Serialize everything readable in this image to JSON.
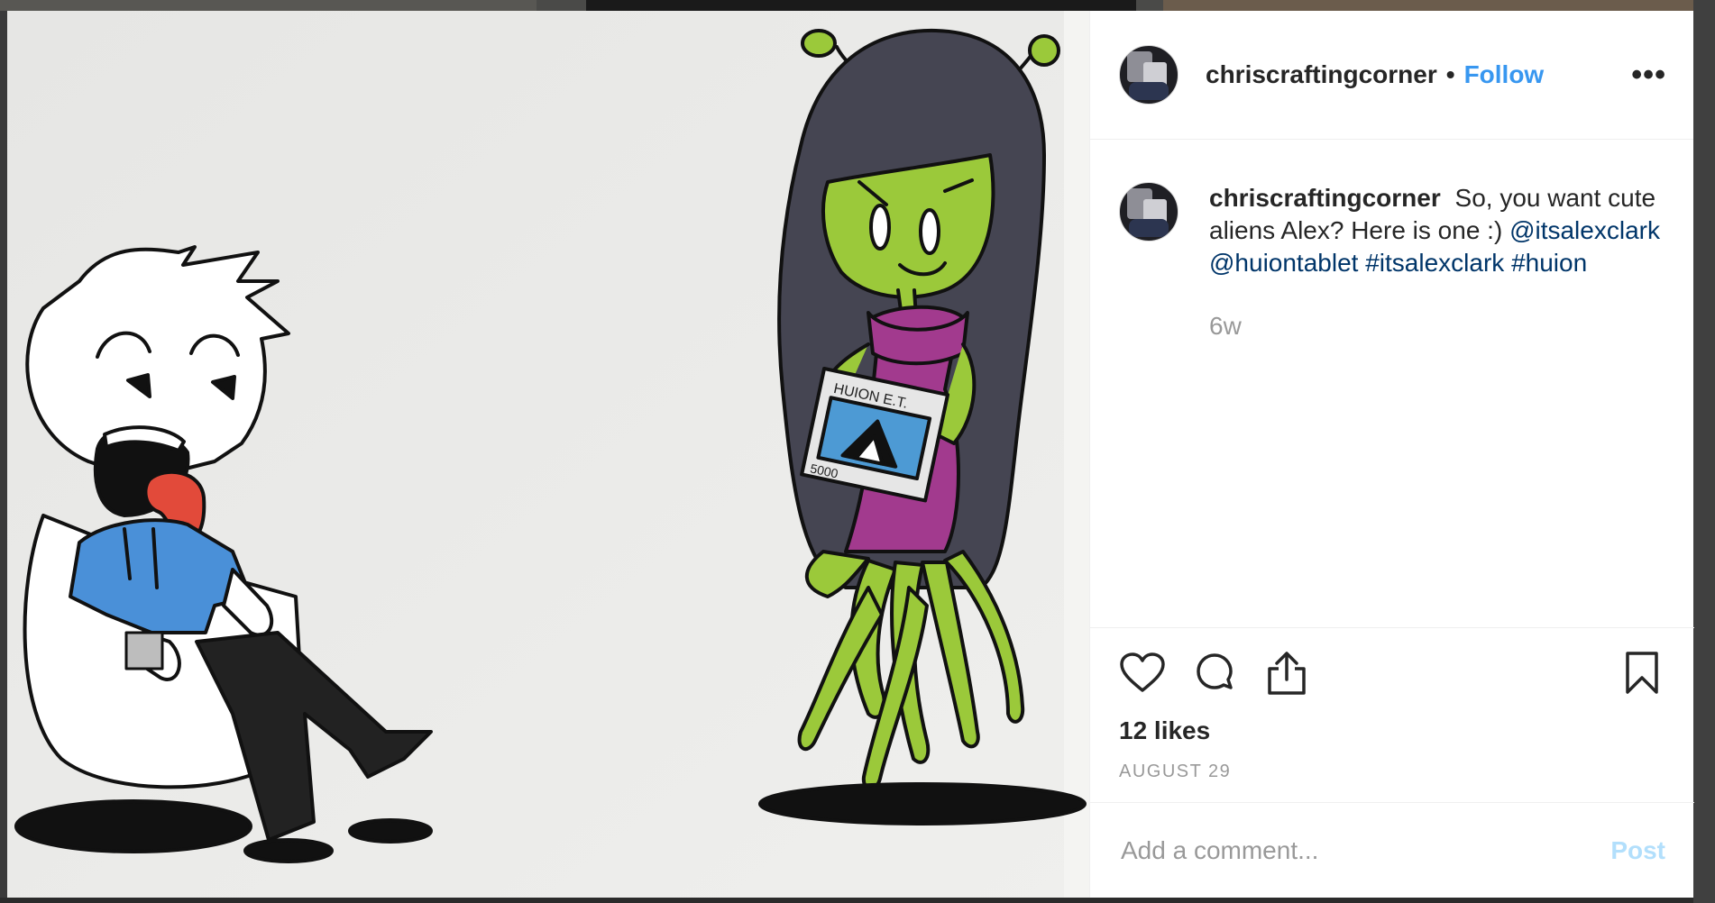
{
  "post": {
    "username": "chriscraftingcorner",
    "separator": "•",
    "follow_label": "Follow",
    "more_label": "•••",
    "caption": {
      "username": "chriscraftingcorner",
      "text": "So, you want cute aliens Alex? Here is one :)",
      "mention1": "@itsalexclark",
      "mention2": "@huiontablet",
      "hashtag1": "#itsalexclark",
      "hashtag2": "#huion"
    },
    "time_ago": "6w",
    "likes": "12 likes",
    "date": "AUGUST 29",
    "comment_placeholder": "Add a comment...",
    "post_label": "Post"
  },
  "drawing": {
    "tablet_label": "HUION E.T.",
    "tablet_model": "5000"
  },
  "colors": {
    "link": "#3897f0",
    "tag": "#003569",
    "muted": "#999999"
  },
  "icons": [
    "heart-icon",
    "comment-icon",
    "share-icon",
    "bookmark-icon"
  ]
}
